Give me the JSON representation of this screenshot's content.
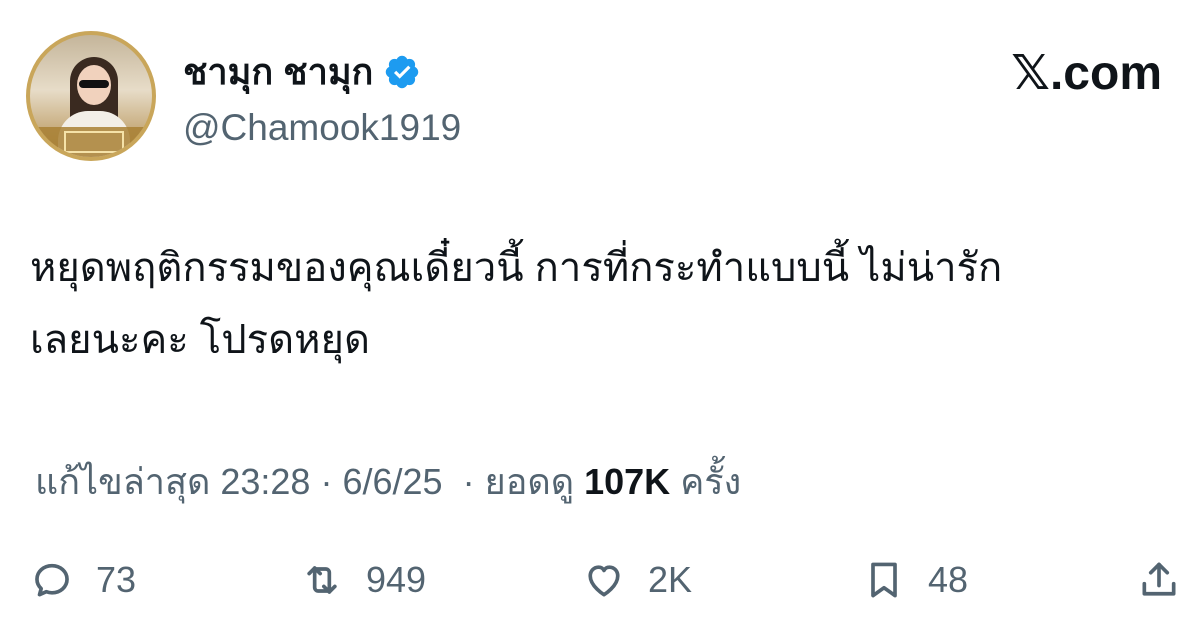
{
  "user": {
    "display_name": "ชามุก ชามุก",
    "handle": "@Chamook1919",
    "verified": true
  },
  "site_label": "𝕏.com",
  "tweet": {
    "text_line1": "หยุดพฤติกรรมของคุณเดี๋ยวนี้ การที่กระทำแบบนี้ ไม่น่ารัก",
    "text_line2": "เลยนะคะ โปรดหยุด"
  },
  "meta": {
    "edited_label": "แก้ไขล่าสุด",
    "time": "23:28",
    "date": "6/6/25",
    "views_label": "ยอดดู",
    "views_count": "107K",
    "views_unit": "ครั้ง"
  },
  "actions": {
    "replies": "73",
    "reposts": "949",
    "likes": "2K",
    "bookmarks": "48"
  },
  "colors": {
    "text_primary": "#0f1419",
    "text_secondary": "#536471",
    "verified_blue": "#1d9bf0",
    "avatar_ring": "#c9a65a"
  }
}
